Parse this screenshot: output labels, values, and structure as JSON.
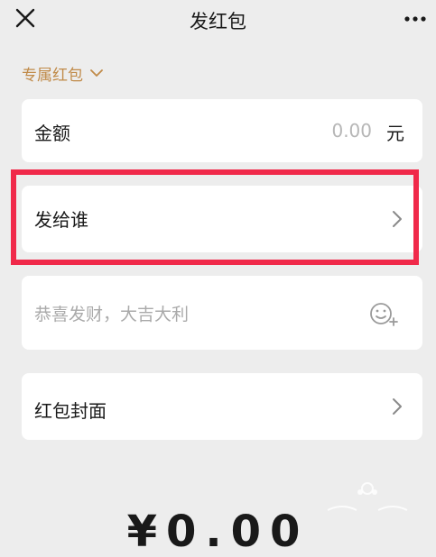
{
  "header": {
    "title": "发红包",
    "close_icon": "close-icon",
    "more_icon": "more-dots-icon"
  },
  "type_select": {
    "label": "专属红包",
    "icon": "chevron-down-icon"
  },
  "amount": {
    "label": "金额",
    "value": "0.00",
    "unit": "元"
  },
  "recipient": {
    "label": "发给谁",
    "icon": "chevron-right-icon"
  },
  "message": {
    "placeholder": "恭喜发财，大吉大利",
    "icon": "emoji-add-icon"
  },
  "cover": {
    "label": "红包封面",
    "icon": "chevron-right-icon"
  },
  "total": {
    "text": "¥0.00"
  },
  "colors": {
    "background": "#ededed",
    "accent_gold": "#c08a48",
    "highlight_red": "#f0294a"
  }
}
